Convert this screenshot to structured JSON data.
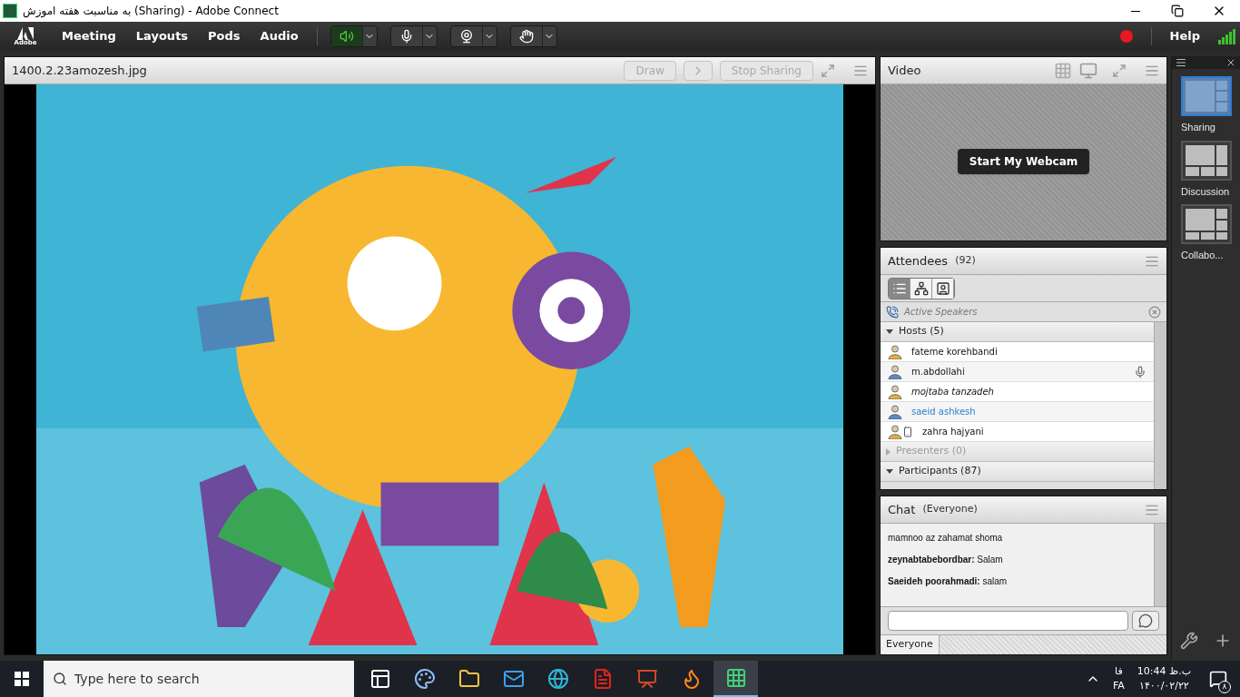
{
  "window": {
    "title": "به مناسبت هفته اموزش (Sharing) - Adobe Connect"
  },
  "menu_bar": {
    "logo": "Adobe",
    "items": [
      "Meeting",
      "Layouts",
      "Pods",
      "Audio"
    ],
    "help": "Help",
    "recording": true,
    "media_buttons": [
      {
        "kind": "speaker",
        "on": true
      },
      {
        "kind": "microphone",
        "on": false
      },
      {
        "kind": "webcam",
        "on": false
      },
      {
        "kind": "hand",
        "on": false
      }
    ]
  },
  "share_pod": {
    "title": "1400.2.23amozesh.jpg",
    "buttons": [
      {
        "label": "Draw",
        "disabled": true
      },
      {
        "label": "Stop Sharing",
        "disabled": true
      }
    ]
  },
  "video_pod": {
    "title": "Video",
    "button": "Start My Webcam"
  },
  "attendees": {
    "title": "Attendees",
    "count": "(92)",
    "views": [
      {
        "kind": "list",
        "selected": true
      },
      {
        "kind": "breakout",
        "selected": false
      },
      {
        "kind": "status",
        "selected": false
      }
    ],
    "active_speakers": "Active Speakers",
    "groups": [
      {
        "label": "Hosts (5)",
        "expanded": true,
        "children": [
          {
            "name": "fateme korehbandi",
            "color": "#e0b040",
            "kind": "plain",
            "speaking": false,
            "mobile": false
          },
          {
            "name": "m.abdollahi",
            "color": "#5a8ac8",
            "kind": "plain",
            "speaking": true,
            "mobile": false
          },
          {
            "name": "mojtaba tanzadeh",
            "color": "#e0b040",
            "kind": "italic",
            "speaking": false,
            "mobile": false
          },
          {
            "name": "saeid ashkesh",
            "color": "#5a8ac8",
            "kind": "self",
            "speaking": false,
            "mobile": false
          },
          {
            "name": "zahra hajyani",
            "color": "#e0b040",
            "kind": "plain",
            "speaking": false,
            "mobile": true
          }
        ]
      },
      {
        "label": "Presenters (0)",
        "expanded": false
      },
      {
        "label": "Participants (87)",
        "expanded": true
      }
    ]
  },
  "chat": {
    "title": "Chat",
    "scope": "(Everyone)",
    "messages": [
      {
        "text": "mamnoo az zahamat shoma"
      },
      {
        "sender": "zeynabtabebordbar:",
        "text": "Salam"
      },
      {
        "sender": "Saeideh poorahmadi:",
        "text": "salam"
      }
    ],
    "tab": "Everyone"
  },
  "layouts": [
    {
      "label": "Sharing",
      "selected": true,
      "kind": "sharing"
    },
    {
      "label": "Discussion",
      "selected": false,
      "kind": "discussion"
    },
    {
      "label": "Collabo...",
      "selected": false,
      "kind": "collab"
    }
  ],
  "taskbar": {
    "search_placeholder": "Type here to search",
    "apps": [
      {
        "kind": "taskview",
        "active": false
      },
      {
        "kind": "paint",
        "active": false
      },
      {
        "kind": "folder",
        "active": false
      },
      {
        "kind": "mail",
        "active": false
      },
      {
        "kind": "edge",
        "active": false
      },
      {
        "kind": "pdf",
        "active": false
      },
      {
        "kind": "powerpoint",
        "active": false
      },
      {
        "kind": "firefox",
        "active": false
      },
      {
        "kind": "connect",
        "active": true
      }
    ],
    "lang_native": "فا",
    "lang": "FA",
    "time": "10:44 ب.ظ",
    "date": "۱۴۰۰/۰۲/۲۲",
    "notifications": "۸"
  }
}
